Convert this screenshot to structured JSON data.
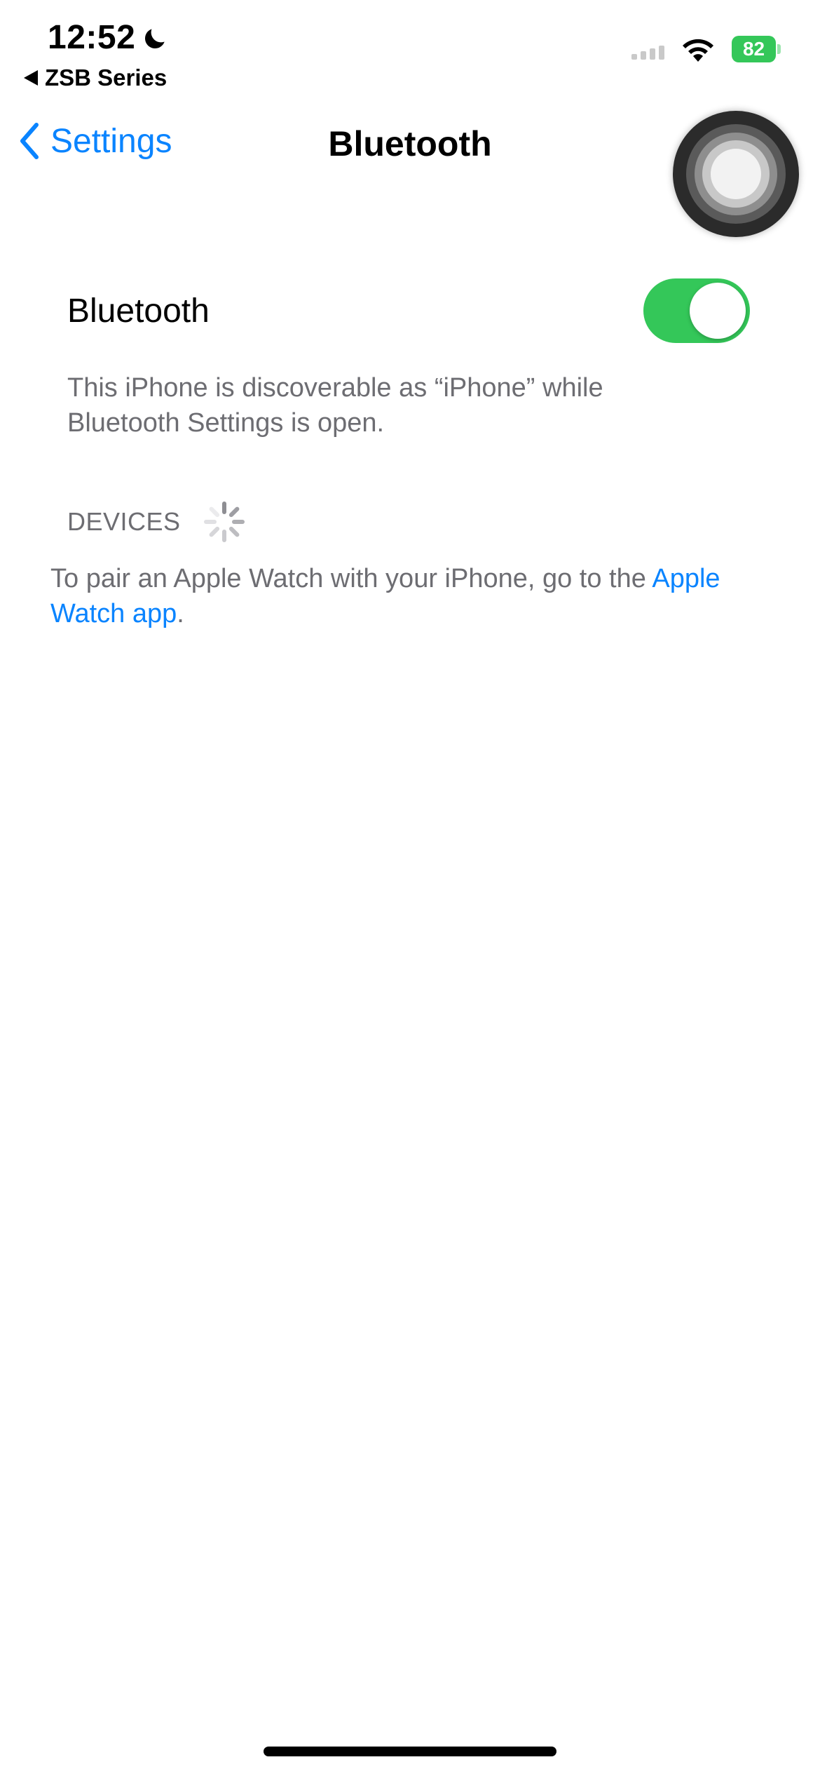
{
  "status_bar": {
    "time": "12:52",
    "back_app": "ZSB Series",
    "battery_level": "82",
    "battery_color": "#34c759"
  },
  "nav": {
    "back_label": "Settings",
    "title": "Bluetooth"
  },
  "bluetooth": {
    "label": "Bluetooth",
    "enabled": true,
    "toggle_color": "#34c759",
    "discoverable_text": "This iPhone is discoverable as “iPhone” while Bluetooth Settings is open."
  },
  "devices": {
    "header": "DEVICES"
  },
  "pair_note": {
    "text": "To pair an Apple Watch with your iPhone, go to the ",
    "link": "Apple Watch app",
    "suffix": "."
  },
  "accent_color": "#0a84ff"
}
